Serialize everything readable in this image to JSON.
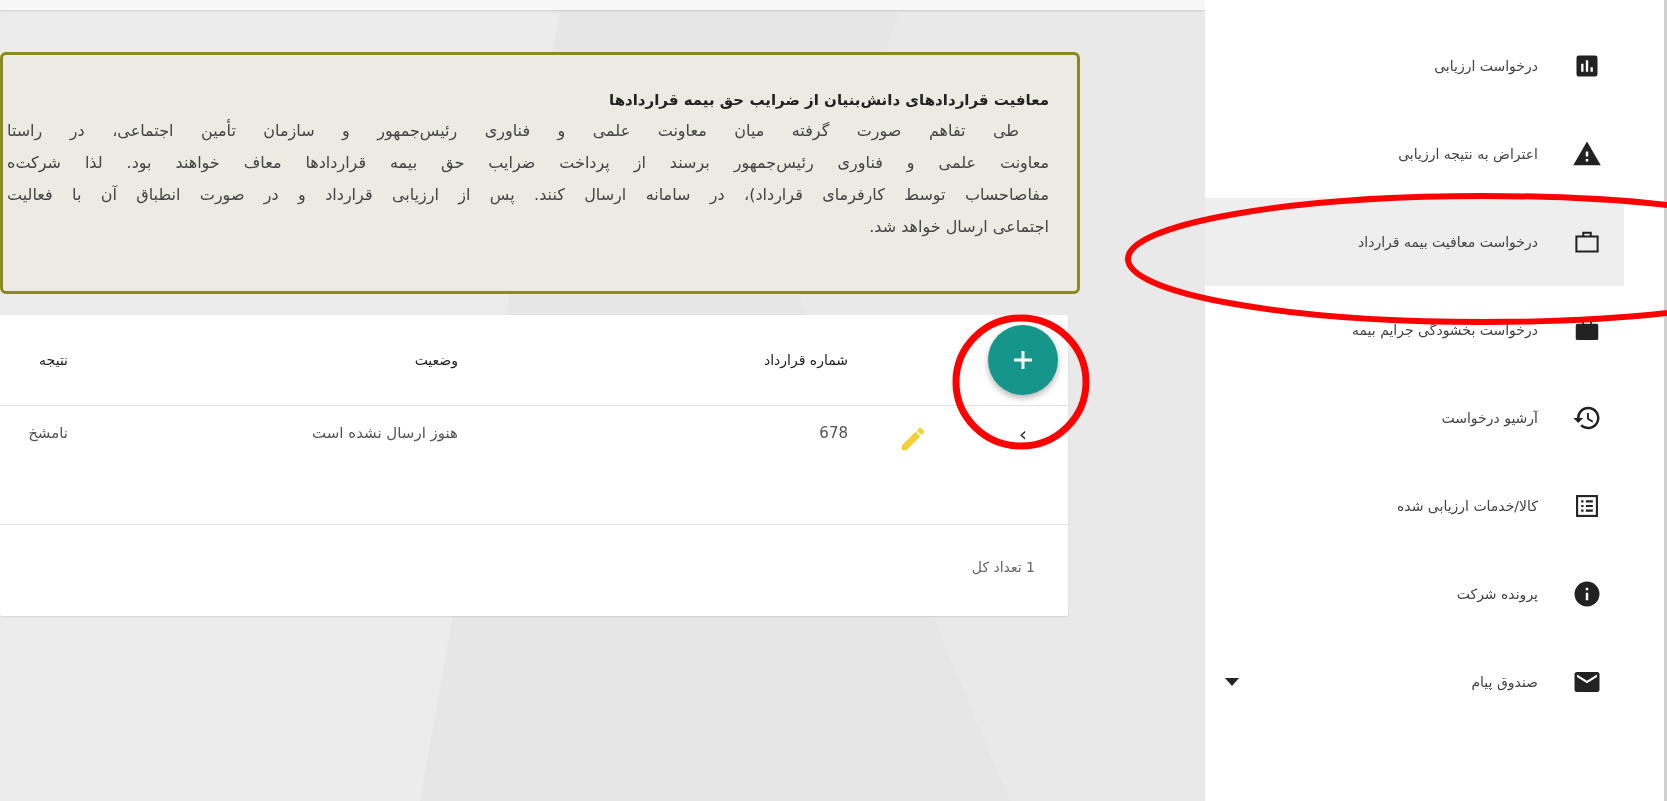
{
  "notice": {
    "title": "معافیت قراردادهای دانش‌بنیان از ضرایب حق بیمه قراردادها",
    "lines": [
      "طی تفاهم صورت گرفته میان معاونت علمی و فناوری رئیس‌جمهور و سازمان تأمین اجتماعی، در راستا",
      "معاونت علمی و فناوری رئیس‌جمهور برسند از پرداخت ضرایب حق بیمه قراردادها معاف خواهند بود. لذا شرکت‌ه",
      "مفاصاحساب توسط کارفرمای قرارداد)، در سامانه ارسال کنند. پس از ارزیابی قرارداد و در صورت انطباق آن با فعالیت",
      "اجتماعی ارسال خواهد شد."
    ]
  },
  "table": {
    "columns": [
      "شماره قرارداد",
      "وضعیت",
      "نتیجه"
    ],
    "rows": [
      {
        "expand": "›",
        "cells": [
          "678",
          "هنوز ارسال نشده است",
          "نامشخ"
        ]
      }
    ],
    "footer": "1 تعداد کل"
  },
  "sidebar": {
    "items": [
      {
        "label": "درخواست ارزیابی",
        "kind": "chart",
        "selected": false,
        "has_submenu": false
      },
      {
        "label": "اعتراض به نتیجه ارزیابی",
        "kind": "warning",
        "selected": false,
        "has_submenu": false
      },
      {
        "label": "درخواست معافیت بیمه قرارداد",
        "kind": "briefcase-outline",
        "selected": true,
        "has_submenu": false
      },
      {
        "label": "درخواست بخشودگی جرایم بیمه",
        "kind": "briefcase",
        "selected": false,
        "has_submenu": false
      },
      {
        "label": "آرشیو درخواست",
        "kind": "history",
        "selected": false,
        "has_submenu": false
      },
      {
        "label": "کالا/خدمات ارزیابی شده",
        "kind": "list",
        "selected": false,
        "has_submenu": false
      },
      {
        "label": "پرونده شرکت",
        "kind": "info",
        "selected": false,
        "has_submenu": false
      },
      {
        "label": "صندوق پیام",
        "kind": "mail",
        "selected": false,
        "has_submenu": true
      }
    ]
  },
  "annotations": {
    "sidebar_item_ellipse": true,
    "add_button_circle": true
  }
}
